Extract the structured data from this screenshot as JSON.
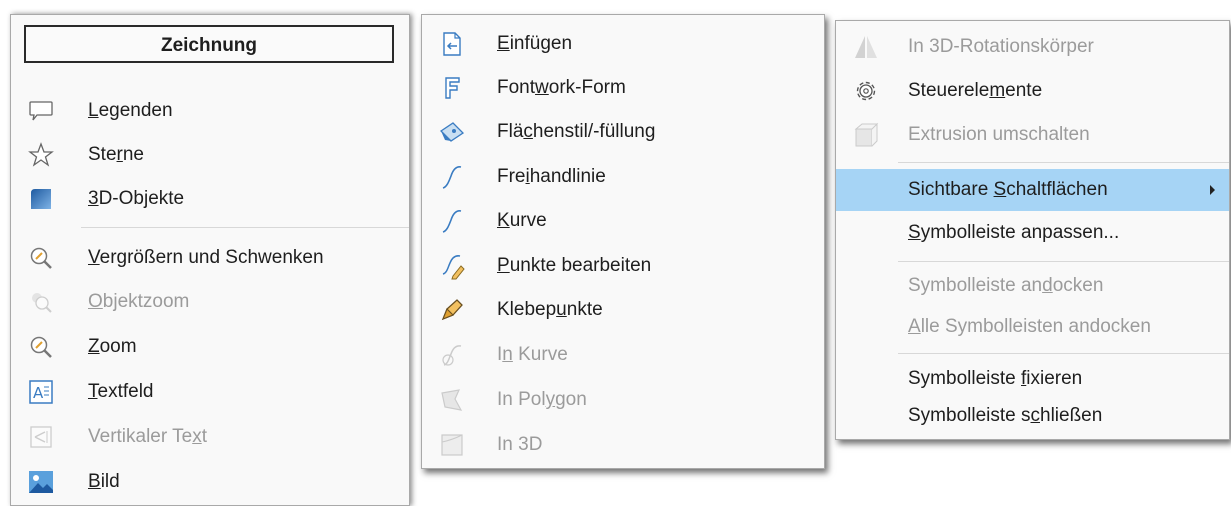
{
  "menu1": {
    "header": "Zeichnung",
    "items": [
      {
        "pre": "",
        "ul": "L",
        "post": "egenden",
        "icon": "callout-icon",
        "enabled": true
      },
      {
        "pre": "Ste",
        "ul": "r",
        "post": "ne",
        "icon": "star-icon",
        "enabled": true
      },
      {
        "pre": "",
        "ul": "3",
        "post": "D-Objekte",
        "icon": "3d-object-icon",
        "enabled": true
      },
      {
        "pre": "",
        "ul": "V",
        "post": "ergrößern und Schwenken",
        "icon": "zoom-pan-icon",
        "enabled": true
      },
      {
        "pre": "",
        "ul": "O",
        "post": "bjektzoom",
        "icon": "object-zoom-icon",
        "enabled": false
      },
      {
        "pre": "",
        "ul": "Z",
        "post": "oom",
        "icon": "zoom-icon",
        "enabled": true
      },
      {
        "pre": "",
        "ul": "T",
        "post": "extfeld",
        "icon": "textbox-icon",
        "enabled": true
      },
      {
        "pre": "Vertikaler Te",
        "ul": "x",
        "post": "t",
        "icon": "vertical-text-icon",
        "enabled": false
      },
      {
        "pre": "",
        "ul": "B",
        "post": "ild",
        "icon": "image-icon",
        "enabled": true
      }
    ]
  },
  "menu2": {
    "items": [
      {
        "pre": "",
        "ul": "E",
        "post": "infügen",
        "icon": "insert-icon",
        "enabled": true
      },
      {
        "pre": "Font",
        "ul": "w",
        "post": "ork-Form",
        "icon": "fontwork-icon",
        "enabled": true
      },
      {
        "pre": "Flä",
        "ul": "c",
        "post": "henstil/-füllung",
        "icon": "area-fill-icon",
        "enabled": true
      },
      {
        "pre": "Fre",
        "ul": "i",
        "post": "handlinie",
        "icon": "freehand-line-icon",
        "enabled": true
      },
      {
        "pre": "",
        "ul": "K",
        "post": "urve",
        "icon": "curve-icon",
        "enabled": true
      },
      {
        "pre": "",
        "ul": "P",
        "post": "unkte bearbeiten",
        "icon": "edit-points-icon",
        "enabled": true
      },
      {
        "pre": "Klebep",
        "ul": "u",
        "post": "nkte",
        "icon": "glue-points-icon",
        "enabled": true
      },
      {
        "pre": "I",
        "ul": "n",
        "post": " Kurve",
        "icon": "to-curve-icon",
        "enabled": false
      },
      {
        "pre": "In Pol",
        "ul": "y",
        "post": "gon",
        "icon": "to-polygon-icon",
        "enabled": false
      },
      {
        "pre": "In 3D",
        "ul": "",
        "post": "",
        "icon": "to-3d-icon",
        "enabled": false
      }
    ]
  },
  "menu3": {
    "items": [
      {
        "pre": "In 3D-Rotationskörper",
        "ul": "",
        "post": "",
        "icon": "rotation-body-icon",
        "enabled": false
      },
      {
        "pre": "Steuerele",
        "ul": "m",
        "post": "ente",
        "icon": "gear-icon",
        "enabled": true
      },
      {
        "pre": "Extrusion umschalten",
        "ul": "",
        "post": "",
        "icon": "extrusion-icon",
        "enabled": false
      },
      {
        "pre": "Sichtbare ",
        "ul": "S",
        "post": "chaltflächen",
        "icon": "",
        "enabled": true,
        "highlighted": true,
        "submenu": true
      },
      {
        "pre": "",
        "ul": "S",
        "post": "ymbolleiste anpassen...",
        "icon": "",
        "enabled": true
      },
      {
        "pre": "Symbolleiste an",
        "ul": "d",
        "post": "ocken",
        "icon": "",
        "enabled": false
      },
      {
        "pre": "",
        "ul": "A",
        "post": "lle Symbolleisten andocken",
        "icon": "",
        "enabled": false
      },
      {
        "pre": "Symbolleiste ",
        "ul": "f",
        "post": "ixieren",
        "icon": "",
        "enabled": true
      },
      {
        "pre": "Symbolleiste s",
        "ul": "c",
        "post": "hließen",
        "icon": "",
        "enabled": true
      }
    ]
  },
  "colors": {
    "highlight": "#a6d4f5",
    "disabled_text": "#9b9b9b",
    "icon_blue": "#3a7cc2"
  }
}
